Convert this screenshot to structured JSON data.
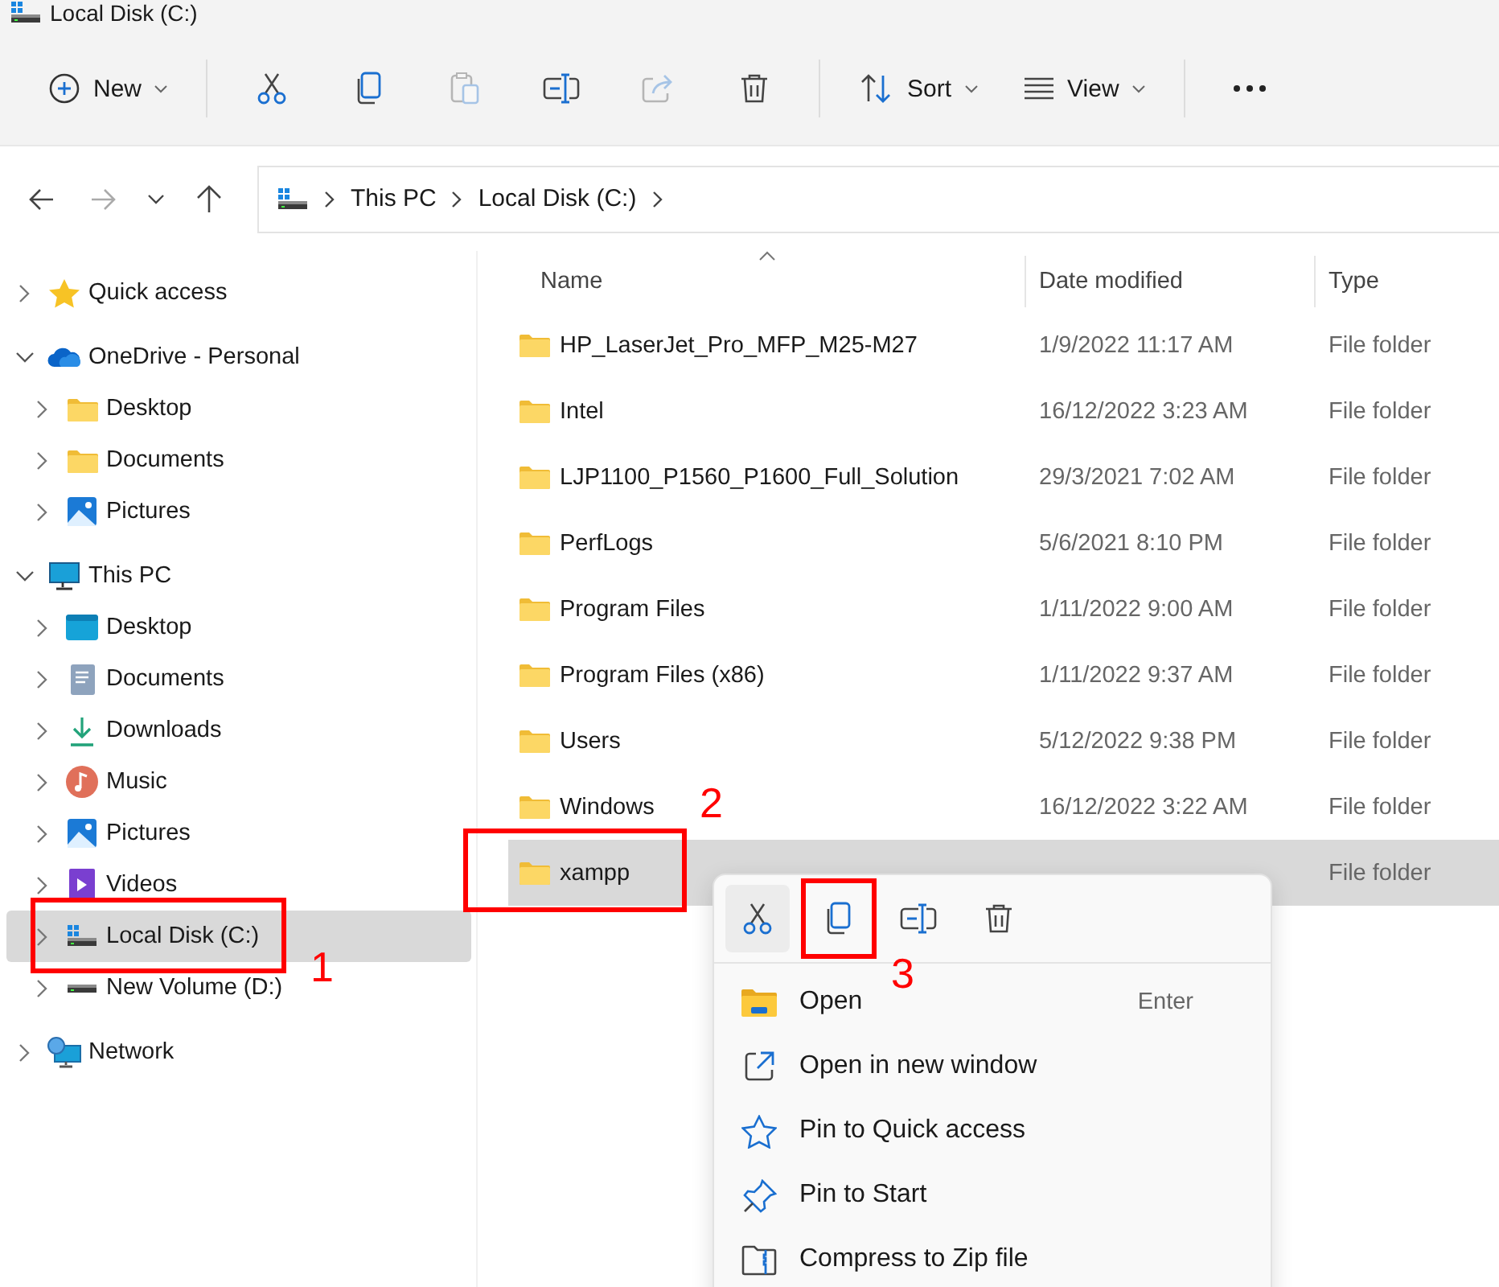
{
  "window": {
    "title": "Local Disk (C:)"
  },
  "toolbar": {
    "groups": [
      [
        {
          "kind": "new",
          "label": "New",
          "dropdown": true,
          "disabled": false
        }
      ],
      [
        {
          "kind": "cut",
          "disabled": false
        },
        {
          "kind": "copy",
          "disabled": false
        },
        {
          "kind": "paste",
          "disabled": true
        },
        {
          "kind": "rename",
          "disabled": false
        },
        {
          "kind": "share",
          "disabled": true
        },
        {
          "kind": "delete",
          "disabled": false
        }
      ],
      [
        {
          "kind": "sort",
          "label": "Sort",
          "dropdown": true,
          "disabled": false
        },
        {
          "kind": "view",
          "label": "View",
          "dropdown": true,
          "disabled": false
        }
      ],
      [
        {
          "kind": "more",
          "disabled": false
        }
      ]
    ]
  },
  "navigation": [
    {
      "kind": "back",
      "disabled": false
    },
    {
      "kind": "forward",
      "disabled": true
    },
    {
      "kind": "recent",
      "disabled": false
    },
    {
      "kind": "up",
      "disabled": false
    }
  ],
  "address_bar": {
    "breadcrumbs": [
      "This PC",
      "Local Disk (C:)"
    ]
  },
  "sidebar": {
    "items": [
      {
        "label": "Quick access",
        "kind": "star",
        "expanded": false,
        "selected": false
      },
      {
        "label": "OneDrive - Personal",
        "kind": "cloud",
        "expanded": true,
        "selected": false,
        "children": [
          {
            "label": "Desktop",
            "kind": "folder",
            "expanded": false,
            "selected": false
          },
          {
            "label": "Documents",
            "kind": "folder",
            "expanded": false,
            "selected": false
          },
          {
            "label": "Pictures",
            "kind": "pictures",
            "expanded": false,
            "selected": false
          }
        ]
      },
      {
        "label": "This PC",
        "kind": "monitor",
        "expanded": true,
        "selected": false,
        "children": [
          {
            "label": "Desktop",
            "kind": "desktop",
            "expanded": false,
            "selected": false
          },
          {
            "label": "Documents",
            "kind": "document",
            "expanded": false,
            "selected": false
          },
          {
            "label": "Downloads",
            "kind": "download",
            "expanded": false,
            "selected": false
          },
          {
            "label": "Music",
            "kind": "music",
            "expanded": false,
            "selected": false
          },
          {
            "label": "Pictures",
            "kind": "pictures",
            "expanded": false,
            "selected": false
          },
          {
            "label": "Videos",
            "kind": "video",
            "expanded": false,
            "selected": false
          },
          {
            "label": "Local Disk (C:)",
            "kind": "system-drive",
            "expanded": false,
            "selected": true
          },
          {
            "label": "New Volume (D:)",
            "kind": "drive",
            "expanded": false,
            "selected": false
          }
        ]
      },
      {
        "label": "Network",
        "kind": "network",
        "expanded": false,
        "selected": false
      }
    ]
  },
  "table": {
    "columns": [
      {
        "label": "Name",
        "sorted": true
      },
      {
        "label": "Date modified",
        "sorted": false
      },
      {
        "label": "Type",
        "sorted": false
      }
    ],
    "rows": [
      {
        "name": "HP_LaserJet_Pro_MFP_M25-M27",
        "date": "1/9/2022 11:17 AM",
        "type": "File folder",
        "selected": false
      },
      {
        "name": "Intel",
        "date": "16/12/2022 3:23 AM",
        "type": "File folder",
        "selected": false
      },
      {
        "name": "LJP1100_P1560_P1600_Full_Solution",
        "date": "29/3/2021 7:02 AM",
        "type": "File folder",
        "selected": false
      },
      {
        "name": "PerfLogs",
        "date": "5/6/2021 8:10 PM",
        "type": "File folder",
        "selected": false
      },
      {
        "name": "Program Files",
        "date": "1/11/2022 9:00 AM",
        "type": "File folder",
        "selected": false
      },
      {
        "name": "Program Files (x86)",
        "date": "1/11/2022 9:37 AM",
        "type": "File folder",
        "selected": false
      },
      {
        "name": "Users",
        "date": "5/12/2022 9:38 PM",
        "type": "File folder",
        "selected": false
      },
      {
        "name": "Windows",
        "date": "16/12/2022 3:22 AM",
        "type": "File folder",
        "selected": false
      },
      {
        "name": "xampp",
        "type": "File folder",
        "selected": true
      }
    ]
  },
  "context_menu": {
    "tools": [
      {
        "kind": "cut",
        "highlighted": true
      },
      {
        "kind": "copy",
        "highlighted": false
      },
      {
        "kind": "rename",
        "highlighted": false
      },
      {
        "kind": "delete",
        "highlighted": false
      }
    ],
    "items": [
      {
        "kind": "open",
        "label": "Open",
        "shortcut": "Enter"
      },
      {
        "kind": "new-window",
        "label": "Open in new window"
      },
      {
        "kind": "pin-quick",
        "label": "Pin to Quick access"
      },
      {
        "kind": "pin-start",
        "label": "Pin to Start"
      },
      {
        "kind": "zip",
        "label": "Compress to Zip file"
      }
    ]
  },
  "annotations": [
    {
      "label": "1"
    },
    {
      "label": "2"
    },
    {
      "label": "3"
    }
  ]
}
